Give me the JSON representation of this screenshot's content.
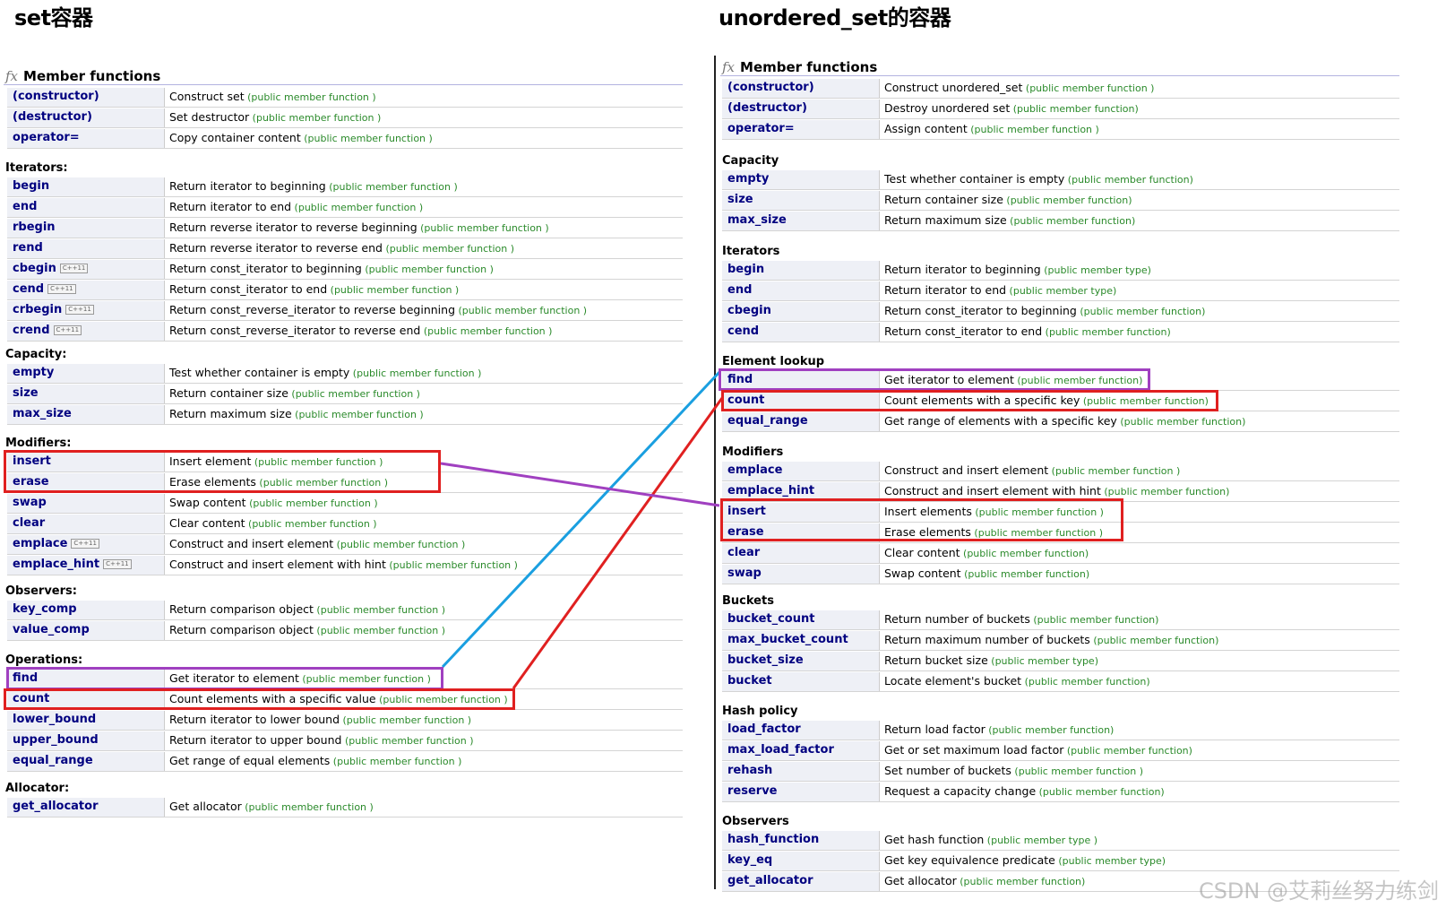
{
  "left": {
    "title": "set容器",
    "member_functions_label": "Member functions",
    "sections": [
      {
        "title": "",
        "rows": [
          {
            "name": "(constructor)",
            "desc": "Construct set",
            "kind": "(public member function )"
          },
          {
            "name": "(destructor)",
            "desc": "Set destructor",
            "kind": "(public member function )"
          },
          {
            "name": "operator=",
            "desc": "Copy container content",
            "kind": "(public member function )"
          }
        ]
      },
      {
        "title": "Iterators:",
        "rows": [
          {
            "name": "begin",
            "desc": "Return iterator to beginning",
            "kind": "(public member function )"
          },
          {
            "name": "end",
            "desc": "Return iterator to end",
            "kind": "(public member function )"
          },
          {
            "name": "rbegin",
            "desc": "Return reverse iterator to reverse beginning",
            "kind": "(public member function )"
          },
          {
            "name": "rend",
            "desc": "Return reverse iterator to reverse end",
            "kind": "(public member function )"
          },
          {
            "name": "cbegin",
            "badge": "C++11",
            "desc": "Return const_iterator to beginning",
            "kind": "(public member function )"
          },
          {
            "name": "cend",
            "badge": "C++11",
            "desc": "Return const_iterator to end",
            "kind": "(public member function )"
          },
          {
            "name": "crbegin",
            "badge": "C++11",
            "desc": "Return const_reverse_iterator to reverse beginning",
            "kind": "(public member function )"
          },
          {
            "name": "crend",
            "badge": "C++11",
            "desc": "Return const_reverse_iterator to reverse end",
            "kind": "(public member function )"
          }
        ]
      },
      {
        "title": "Capacity:",
        "rows": [
          {
            "name": "empty",
            "desc": "Test whether container is empty",
            "kind": "(public member function )"
          },
          {
            "name": "size",
            "desc": "Return container size",
            "kind": "(public member function )"
          },
          {
            "name": "max_size",
            "desc": "Return maximum size",
            "kind": "(public member function )"
          }
        ]
      },
      {
        "title": "Modifiers:",
        "rows": [
          {
            "name": "insert",
            "desc": "Insert element",
            "kind": "(public member function )"
          },
          {
            "name": "erase",
            "desc": "Erase elements",
            "kind": "(public member function )"
          },
          {
            "name": "swap",
            "desc": "Swap content",
            "kind": "(public member function )"
          },
          {
            "name": "clear",
            "desc": "Clear content",
            "kind": "(public member function )"
          },
          {
            "name": "emplace",
            "badge": "C++11",
            "desc": "Construct and insert element",
            "kind": "(public member function )"
          },
          {
            "name": "emplace_hint",
            "badge": "C++11",
            "desc": "Construct and insert element with hint",
            "kind": "(public member function )"
          }
        ]
      },
      {
        "title": "Observers:",
        "rows": [
          {
            "name": "key_comp",
            "desc": "Return comparison object",
            "kind": "(public member function )"
          },
          {
            "name": "value_comp",
            "desc": "Return comparison object",
            "kind": "(public member function )"
          }
        ]
      },
      {
        "title": "Operations:",
        "rows": [
          {
            "name": "find",
            "desc": "Get iterator to element",
            "kind": "(public member function )"
          },
          {
            "name": "count",
            "desc": "Count elements with a specific value",
            "kind": "(public member function )"
          },
          {
            "name": "lower_bound",
            "desc": "Return iterator to lower bound",
            "kind": "(public member function )"
          },
          {
            "name": "upper_bound",
            "desc": "Return iterator to upper bound",
            "kind": "(public member function )"
          },
          {
            "name": "equal_range",
            "desc": "Get range of equal elements",
            "kind": "(public member function )"
          }
        ]
      },
      {
        "title": "Allocator:",
        "rows": [
          {
            "name": "get_allocator",
            "desc": "Get allocator",
            "kind": "(public member function )"
          }
        ]
      }
    ]
  },
  "right": {
    "title": "unordered_set的容器",
    "member_functions_label": "Member functions",
    "sections": [
      {
        "title": "",
        "rows": [
          {
            "name": "(constructor)",
            "desc": "Construct unordered_set",
            "kind": "(public member function )"
          },
          {
            "name": "(destructor)",
            "desc": "Destroy unordered set",
            "kind": "(public member function)"
          },
          {
            "name": "operator=",
            "desc": "Assign content",
            "kind": "(public member function )"
          }
        ]
      },
      {
        "title": "Capacity",
        "rows": [
          {
            "name": "empty",
            "desc": "Test whether container is empty",
            "kind": "(public member function)"
          },
          {
            "name": "size",
            "desc": "Return container size",
            "kind": "(public member function)"
          },
          {
            "name": "max_size",
            "desc": "Return maximum size",
            "kind": "(public member function)"
          }
        ]
      },
      {
        "title": "Iterators",
        "rows": [
          {
            "name": "begin",
            "desc": "Return iterator to beginning",
            "kind": "(public member type)"
          },
          {
            "name": "end",
            "desc": "Return iterator to end",
            "kind": "(public member type)"
          },
          {
            "name": "cbegin",
            "desc": "Return const_iterator to beginning",
            "kind": "(public member function)"
          },
          {
            "name": "cend",
            "desc": "Return const_iterator to end",
            "kind": "(public member function)"
          }
        ]
      },
      {
        "title": "Element lookup",
        "rows": [
          {
            "name": "find",
            "desc": "Get iterator to element",
            "kind": "(public member function)"
          },
          {
            "name": "count",
            "desc": "Count elements with a specific key",
            "kind": "(public member function)"
          },
          {
            "name": "equal_range",
            "desc": "Get range of elements with a specific key",
            "kind": "(public member function)"
          }
        ]
      },
      {
        "title": "Modifiers",
        "rows": [
          {
            "name": "emplace",
            "desc": "Construct and insert element",
            "kind": "(public member function )"
          },
          {
            "name": "emplace_hint",
            "desc": "Construct and insert element with hint",
            "kind": "(public member function)"
          },
          {
            "name": "insert",
            "desc": "Insert elements",
            "kind": "(public member function )"
          },
          {
            "name": "erase",
            "desc": "Erase elements",
            "kind": "(public member function )"
          },
          {
            "name": "clear",
            "desc": "Clear content",
            "kind": "(public member function)"
          },
          {
            "name": "swap",
            "desc": "Swap content",
            "kind": "(public member function)"
          }
        ]
      },
      {
        "title": "Buckets",
        "rows": [
          {
            "name": "bucket_count",
            "desc": "Return number of buckets",
            "kind": "(public member function)"
          },
          {
            "name": "max_bucket_count",
            "desc": "Return maximum number of buckets",
            "kind": "(public member function)"
          },
          {
            "name": "bucket_size",
            "desc": "Return bucket size",
            "kind": "(public member type)"
          },
          {
            "name": "bucket",
            "desc": "Locate element's bucket",
            "kind": "(public member function)"
          }
        ]
      },
      {
        "title": "Hash policy",
        "rows": [
          {
            "name": "load_factor",
            "desc": "Return load factor",
            "kind": "(public member function)"
          },
          {
            "name": "max_load_factor",
            "desc": "Get or set maximum load factor",
            "kind": "(public member function)"
          },
          {
            "name": "rehash",
            "desc": "Set number of buckets",
            "kind": "(public member function )"
          },
          {
            "name": "reserve",
            "desc": "Request a capacity change",
            "kind": "(public member function)"
          }
        ]
      },
      {
        "title": "Observers",
        "rows": [
          {
            "name": "hash_function",
            "desc": "Get hash function",
            "kind": "(public member type )"
          },
          {
            "name": "key_eq",
            "desc": "Get key equivalence predicate",
            "kind": "(public member type)"
          },
          {
            "name": "get_allocator",
            "desc": "Get allocator",
            "kind": "(public member function)"
          }
        ]
      }
    ]
  },
  "watermark": "CSDN @艾莉丝努力练剑",
  "colors": {
    "highlight_red": "#e02020",
    "highlight_purple": "#a040c0",
    "connector_blue": "#1a9fe0",
    "member_name": "#000080",
    "kind_text": "#2a8a2a"
  }
}
